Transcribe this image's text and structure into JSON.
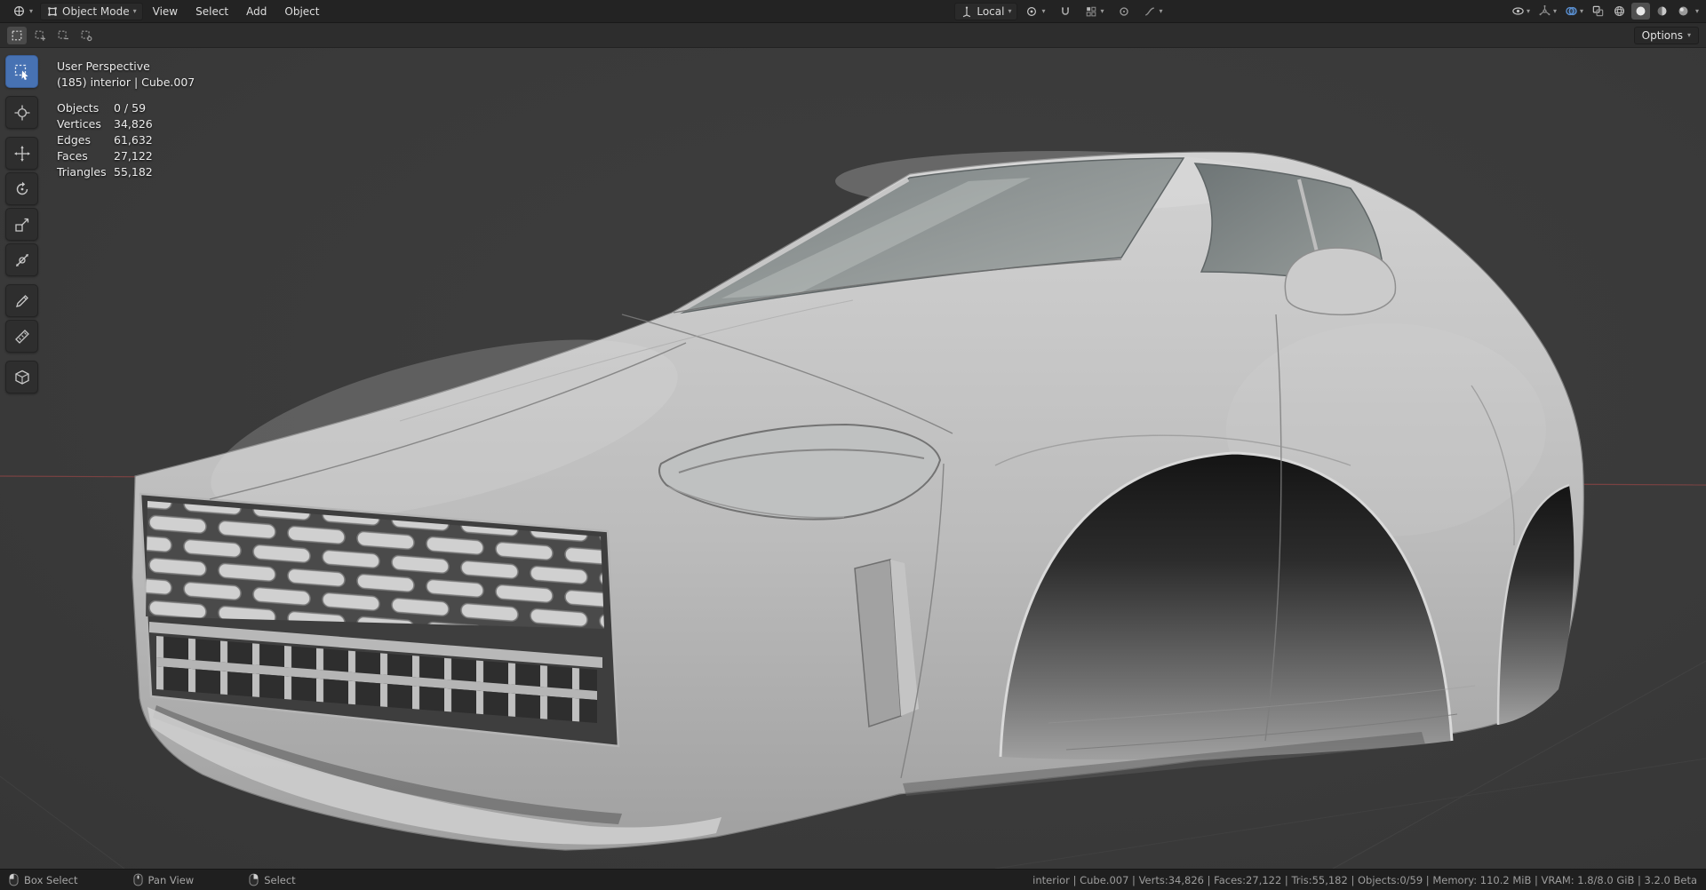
{
  "topbar": {
    "editor_mode": "Object Mode",
    "menus": [
      "View",
      "Select",
      "Add",
      "Object"
    ],
    "transform_orientation": "Local",
    "header_icons": [
      "editor-type-icon",
      "object-mode-icon",
      "orientation-axes-icon",
      "pivot-point-icon",
      "snap-magnet-icon",
      "snap-settings-icon",
      "proportional-edit-icon",
      "proportional-falloff-icon",
      "visibility-eye-icon",
      "gizmos-icon",
      "overlays-icon",
      "xray-icon",
      "shading-wireframe-icon",
      "shading-solid-icon",
      "shading-material-icon",
      "shading-rendered-icon"
    ],
    "active_shading": "solid"
  },
  "toolheader": {
    "select_mode_icons": [
      "select-set-icon",
      "select-extend-icon",
      "select-subtract-icon",
      "select-invert-icon"
    ],
    "options_label": "Options"
  },
  "toolbar": {
    "tools": [
      "select-box",
      "cursor",
      "move",
      "rotate",
      "scale",
      "transform",
      "annotate",
      "measure",
      "add-cube"
    ],
    "active_tool": "select-box",
    "active_color": "#4772b3"
  },
  "viewport": {
    "perspective_label": "User Perspective",
    "context_label": "(185) interior | Cube.007",
    "stats": [
      {
        "label": "Objects",
        "value": "0 / 59"
      },
      {
        "label": "Vertices",
        "value": "34,826"
      },
      {
        "label": "Edges",
        "value": "61,632"
      },
      {
        "label": "Faces",
        "value": "27,122"
      },
      {
        "label": "Triangles",
        "value": "55,182"
      }
    ],
    "axis_x_color": "#8a4545",
    "scene_object": "grey sports car body mesh, front three-quarter view, no wheels"
  },
  "statusbar": {
    "hints": [
      {
        "icon": "mouse-left-icon",
        "label": "Box Select"
      },
      {
        "icon": "mouse-middle-icon",
        "label": "Pan View"
      },
      {
        "icon": "mouse-right-icon",
        "label": "Select"
      }
    ],
    "info": "interior | Cube.007 | Verts:34,826 | Faces:27,122 | Tris:55,182 | Objects:0/59 | Memory: 110.2 MiB | VRAM: 1.8/8.0 GiB | 3.2.0 Beta"
  }
}
